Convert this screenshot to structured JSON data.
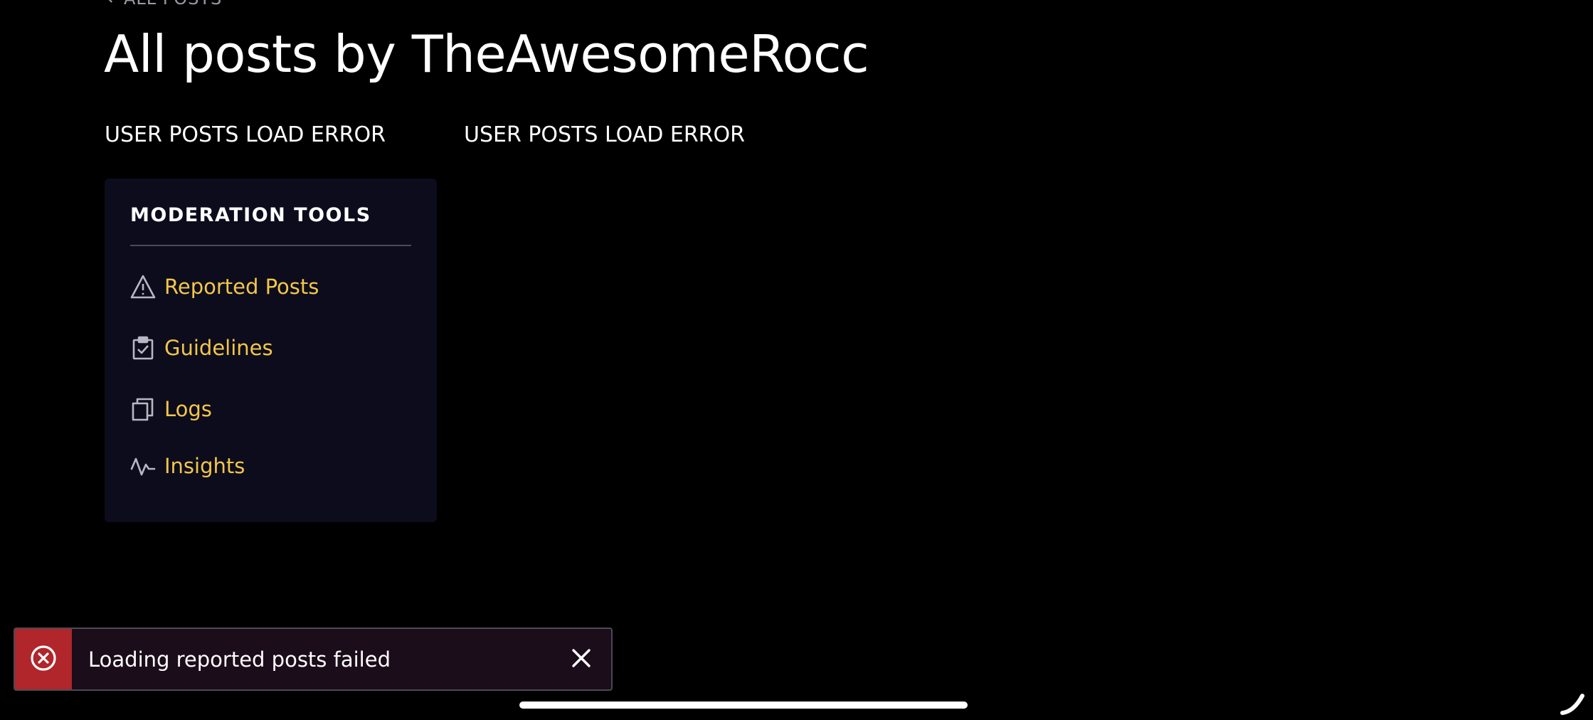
{
  "back_link": {
    "label": "ALL POSTS"
  },
  "header": {
    "title": "All posts by TheAwesomeRocc"
  },
  "errors": {
    "left": "USER POSTS LOAD ERROR",
    "right": "USER POSTS LOAD ERROR"
  },
  "moderation": {
    "title": "MODERATION TOOLS",
    "items": [
      {
        "label": "Reported Posts",
        "icon": "warning-triangle-icon"
      },
      {
        "label": "Guidelines",
        "icon": "clipboard-check-icon"
      },
      {
        "label": "Logs",
        "icon": "copy-documents-icon"
      },
      {
        "label": "Insights",
        "icon": "activity-pulse-icon"
      }
    ]
  },
  "toast": {
    "message": "Loading reported posts failed",
    "icon": "error-circle-x-icon",
    "close_icon": "close-icon"
  },
  "colors": {
    "background": "#000000",
    "panel": "#0c0c1c",
    "accent_link": "#f3c64b",
    "toast_error": "#b0262a",
    "toast_bg": "#1c0d1a"
  }
}
